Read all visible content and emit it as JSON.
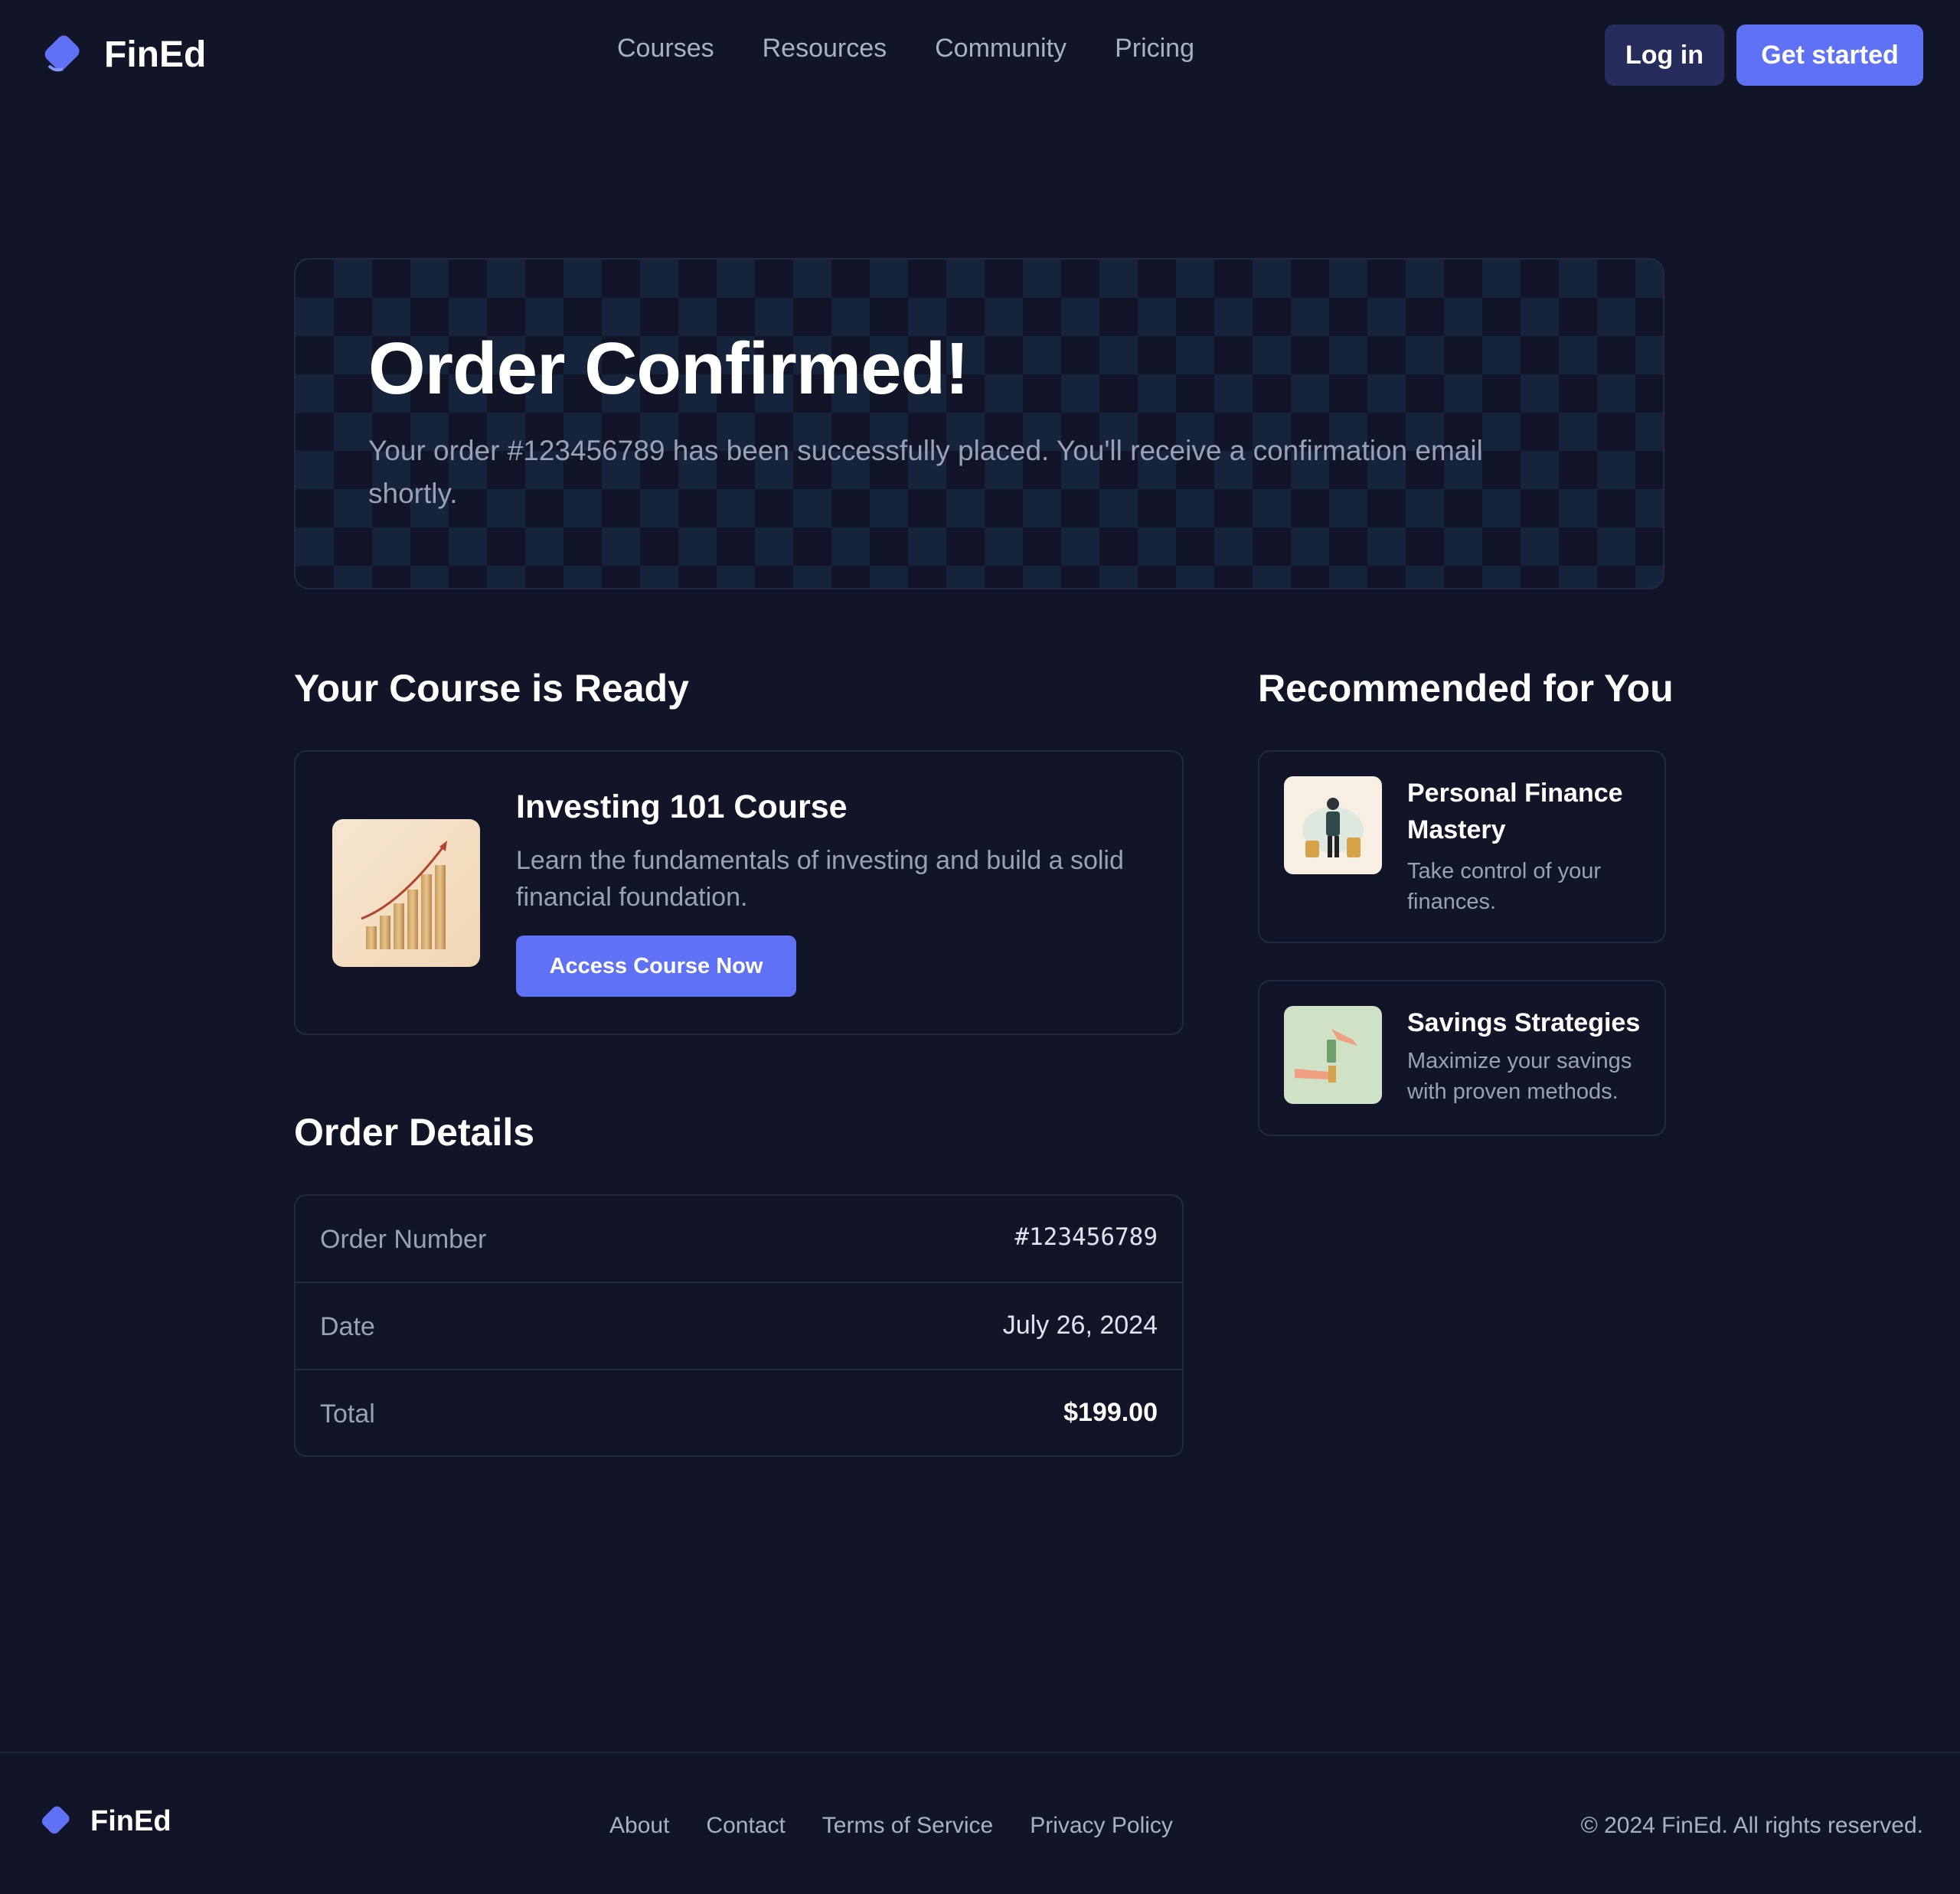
{
  "brand": {
    "name": "FinEd",
    "accent": "#5f72f5"
  },
  "nav": {
    "items": [
      "Courses",
      "Resources",
      "Community",
      "Pricing"
    ]
  },
  "header": {
    "login_label": "Log in",
    "get_started_label": "Get started"
  },
  "hero": {
    "title": "Order Confirmed!",
    "subtitle": "Your order #123456789 has been successfully placed. You'll receive a confirmation email shortly."
  },
  "course_section": {
    "title": "Your Course is Ready",
    "course": {
      "title": "Investing 101 Course",
      "description": "Learn the fundamentals of investing and build a solid financial foundation.",
      "button_label": "Access Course Now",
      "thumbnail_icon": "bar-chart-growth-icon"
    }
  },
  "order_details": {
    "title": "Order Details",
    "rows": [
      {
        "label": "Order Number",
        "value": "#123456789"
      },
      {
        "label": "Date",
        "value": "July 26, 2024"
      },
      {
        "label": "Total",
        "value": "$199.00"
      }
    ]
  },
  "recommended": {
    "title": "Recommended for You",
    "items": [
      {
        "title": "Personal Finance Mastery",
        "description": "Take control of your finances.",
        "thumbnail_icon": "person-with-coins-icon"
      },
      {
        "title": "Savings Strategies",
        "description": "Maximize your savings with proven methods.",
        "thumbnail_icon": "hand-dropping-money-icon"
      }
    ]
  },
  "footer": {
    "links": [
      "About",
      "Contact",
      "Terms of Service",
      "Privacy Policy"
    ],
    "copyright": "© 2024 FinEd. All rights reserved."
  }
}
